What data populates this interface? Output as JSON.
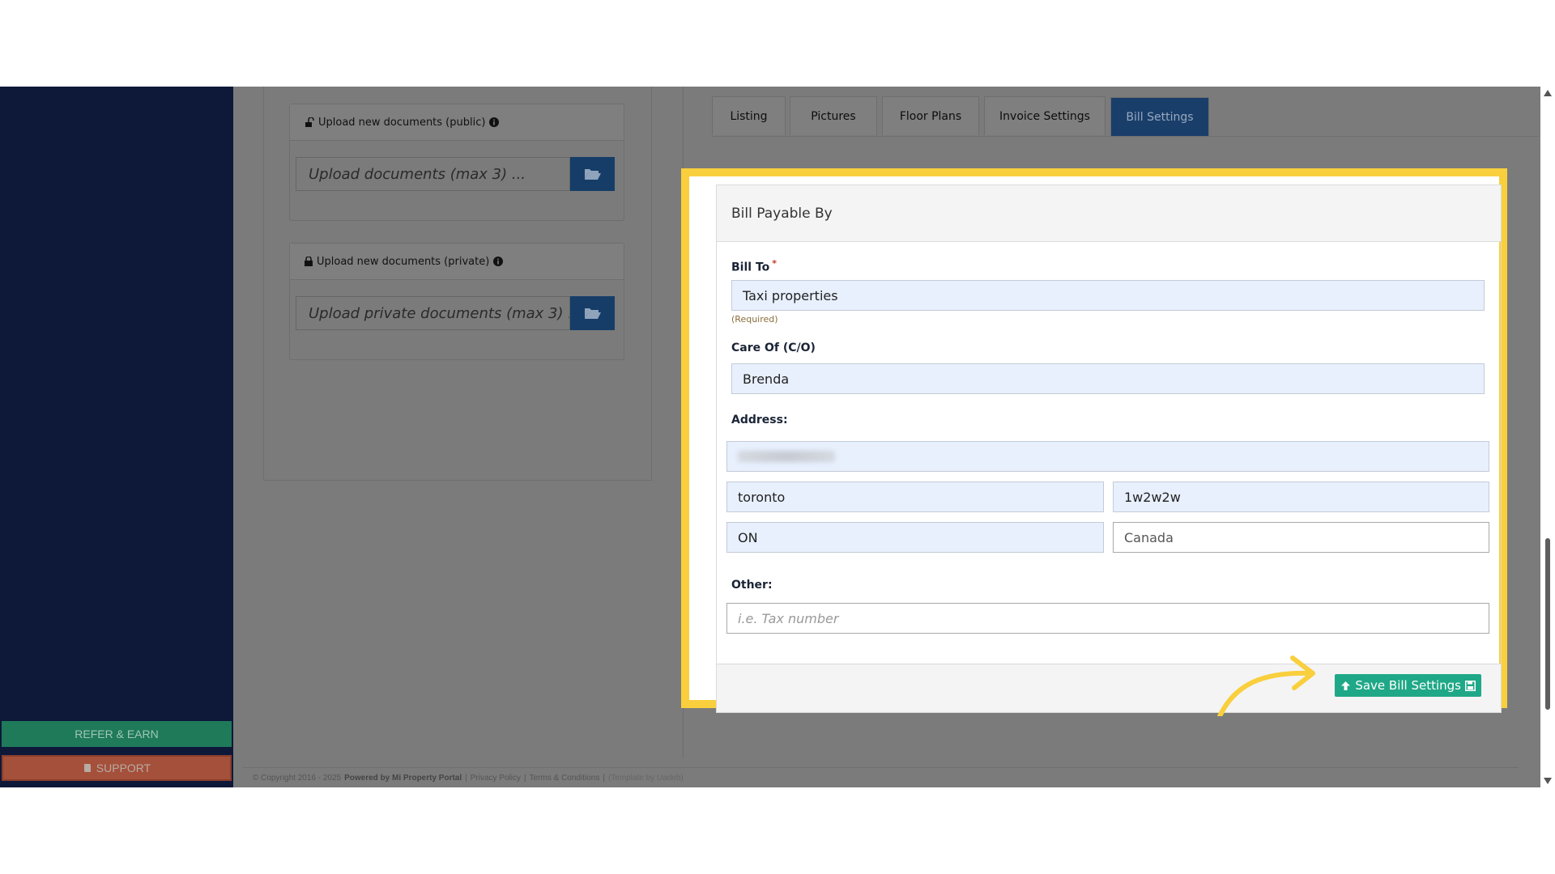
{
  "sidebar": {
    "refer_label": "REFER & EARN",
    "support_label": "SUPPORT"
  },
  "uploads": {
    "public_title": "Upload new documents (public)",
    "public_placeholder": "Upload documents (max 3) ...",
    "private_title": "Upload new documents (private)",
    "private_placeholder": "Upload private documents (max 3) ..."
  },
  "tabs": [
    {
      "label": "Listing"
    },
    {
      "label": "Pictures"
    },
    {
      "label": "Floor Plans"
    },
    {
      "label": "Invoice Settings"
    },
    {
      "label": "Bill Settings",
      "active": true
    }
  ],
  "form": {
    "title": "Bill Payable By",
    "bill_to_label": "Bill To",
    "bill_to_value": "Taxi properties",
    "bill_to_help": "(Required)",
    "care_of_label": "Care Of (C/O)",
    "care_of_value": "Brenda",
    "address_label": "Address:",
    "city": "toronto",
    "postal_code": "1w2w2w",
    "province": "ON",
    "country": "Canada",
    "other_label": "Other:",
    "other_placeholder": "i.e. Tax number",
    "save_label": "Save Bill Settings"
  },
  "footer": {
    "copyright": "© Copyright 2016 - 2025",
    "powered": "Powered by Mi Property Portal",
    "privacy": "Privacy Policy",
    "terms": "Terms & Conditions",
    "template": "(Template by Uadeb)"
  },
  "colors": {
    "highlight": "#f9cf3e",
    "save_button": "#1fa887",
    "active_tab": "#1a3e6a",
    "sidebar": "#0e1838"
  }
}
